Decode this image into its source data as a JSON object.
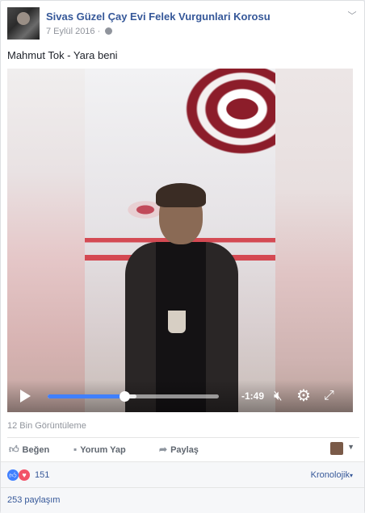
{
  "post": {
    "page_name": "Sivas Güzel Çay Evi Felek Vurgunlari Korosu",
    "date": "7 Eylül 2016",
    "separator": " · ",
    "text": "Mahmut Tok - Yara beni"
  },
  "video": {
    "time_remaining": "-1:49",
    "progress": 0.45,
    "buffered": 0.52
  },
  "stats": {
    "views": "12 Bin Görüntüleme",
    "reaction_count": "151",
    "shares": "253 paylaşım"
  },
  "actions": {
    "like": "Beğen",
    "comment": "Yorum Yap",
    "share": "Paylaş"
  },
  "sort": {
    "label": "Kronolojik"
  },
  "colors": {
    "link": "#365899",
    "progress": "#4080ff",
    "love": "#f25268"
  },
  "icons": [
    "globe-icon",
    "chevron-down-icon",
    "play-icon",
    "volume-mute-icon",
    "gear-icon",
    "fullscreen-icon",
    "like-icon",
    "comment-icon",
    "share-icon",
    "love-icon"
  ]
}
